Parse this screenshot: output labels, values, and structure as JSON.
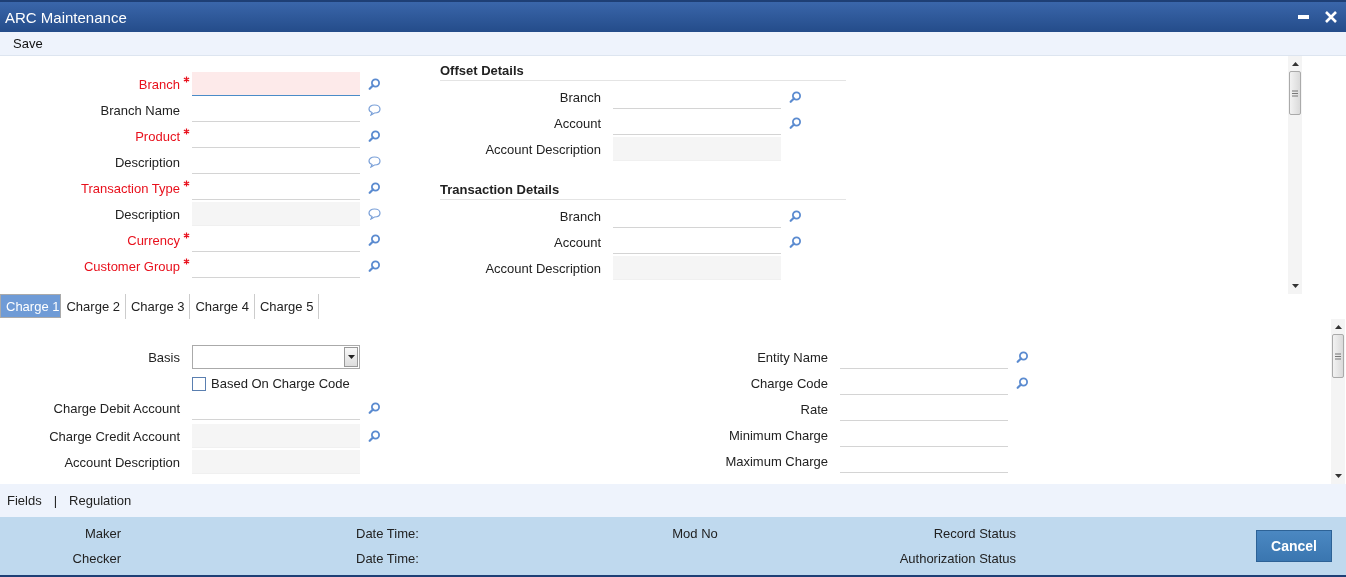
{
  "window": {
    "title": "ARC Maintenance"
  },
  "toolbar": [
    "Save"
  ],
  "main_fields": [
    {
      "kind": "lookup",
      "label": "Branch",
      "required": true,
      "disabled": false,
      "focused": true
    },
    {
      "kind": "note",
      "label": "Branch Name",
      "required": false,
      "disabled": false,
      "focused": false
    },
    {
      "kind": "lookup",
      "label": "Product",
      "required": true,
      "disabled": false,
      "focused": false
    },
    {
      "kind": "note",
      "label": "Description",
      "required": false,
      "disabled": false,
      "focused": false
    },
    {
      "kind": "lookup",
      "label": "Transaction Type",
      "required": true,
      "disabled": false,
      "focused": false
    },
    {
      "kind": "note",
      "label": "Description",
      "required": false,
      "disabled": true,
      "focused": false
    },
    {
      "kind": "lookup",
      "label": "Currency",
      "required": true,
      "disabled": false,
      "focused": false
    },
    {
      "kind": "lookup",
      "label": "Customer Group",
      "required": true,
      "disabled": false,
      "focused": false
    }
  ],
  "sections": [
    {
      "title": "Offset Details",
      "fields": [
        {
          "kind": "lookup",
          "label": "Branch",
          "disabled": false
        },
        {
          "kind": "lookup",
          "label": "Account",
          "disabled": false
        },
        {
          "kind": "text",
          "label": "Account Description",
          "disabled": true
        }
      ]
    },
    {
      "title": "Transaction Details",
      "fields": [
        {
          "kind": "lookup",
          "label": "Branch",
          "disabled": false
        },
        {
          "kind": "lookup",
          "label": "Account",
          "disabled": false
        },
        {
          "kind": "text",
          "label": "Account Description",
          "disabled": true
        }
      ]
    }
  ],
  "tabs": [
    {
      "label": "Charge 1",
      "selected": true
    },
    {
      "label": "Charge 2",
      "selected": false
    },
    {
      "label": "Charge 3",
      "selected": false
    },
    {
      "label": "Charge 4",
      "selected": false
    },
    {
      "label": "Charge 5",
      "selected": false
    }
  ],
  "charge_left": [
    {
      "kind": "select",
      "label": "Basis"
    },
    {
      "kind": "checkbox",
      "label": "Based On Charge Code",
      "checked": false
    },
    {
      "kind": "lookup",
      "label": "Charge Debit Account",
      "disabled": false
    },
    {
      "kind": "lookup",
      "label": "Charge Credit Account",
      "disabled": true
    },
    {
      "kind": "text",
      "label": "Account Description",
      "disabled": true
    }
  ],
  "charge_right": [
    {
      "kind": "lookup",
      "label": "Entity Name",
      "disabled": false
    },
    {
      "kind": "lookup",
      "label": "Charge Code",
      "disabled": false
    },
    {
      "kind": "text",
      "label": "Rate",
      "disabled": false
    },
    {
      "kind": "text",
      "label": "Minimum Charge",
      "disabled": false
    },
    {
      "kind": "text",
      "label": "Maximum Charge",
      "disabled": false
    }
  ],
  "links": [
    {
      "kind": "link",
      "text": "Fields"
    },
    {
      "kind": "separator",
      "text": "|"
    },
    {
      "kind": "link",
      "text": "Regulation"
    }
  ],
  "audit": [
    {
      "top": "Maker",
      "bottom": "Checker"
    },
    {
      "top": "Date Time:",
      "bottom": "Date Time:"
    },
    {
      "top": "Mod No"
    },
    {
      "top": "Record Status",
      "bottom": "Authorization Status"
    }
  ],
  "buttons": [
    "Cancel"
  ]
}
